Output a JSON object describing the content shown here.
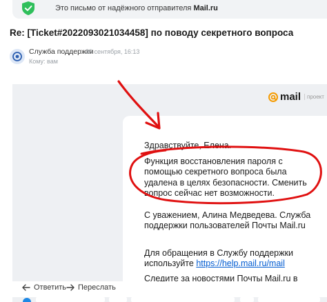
{
  "banner": {
    "text_prefix": "Это письмо от надёжного отправителя ",
    "text_bold": "Mail.ru"
  },
  "message": {
    "subject": "Re: [Ticket#2022093021034458] по поводу секретного вопроса",
    "sender": "Служба поддержки",
    "date": "30 сентября, 16:13",
    "to_label": "Кому: вам"
  },
  "brand": {
    "logo_text": "mail",
    "project_label": "проект"
  },
  "body": {
    "greeting": "Здравствуйте, Елена.",
    "main_text": "Функция восстановления пароля с помощью секретного вопроса была удалена в целях безопасности. Сменить вопрос сейчас нет возможности.",
    "signature": "С уважением, Алина Медведева. Служба поддержки пользователей Почты Mail.ru",
    "contact_prefix": "Для обращения в Службу поддержки используйте ",
    "contact_link": "https://help.mail.ru/mail",
    "follow_partial": "Следите за новостями Почты Mail.ru в нашем"
  },
  "actions": {
    "reply": "Ответить",
    "forward": "Переслать"
  },
  "colors": {
    "shield": "#2fbf5b",
    "annotation": "#e01010",
    "link": "#005bd1",
    "mail_logo": "#f59b00"
  }
}
